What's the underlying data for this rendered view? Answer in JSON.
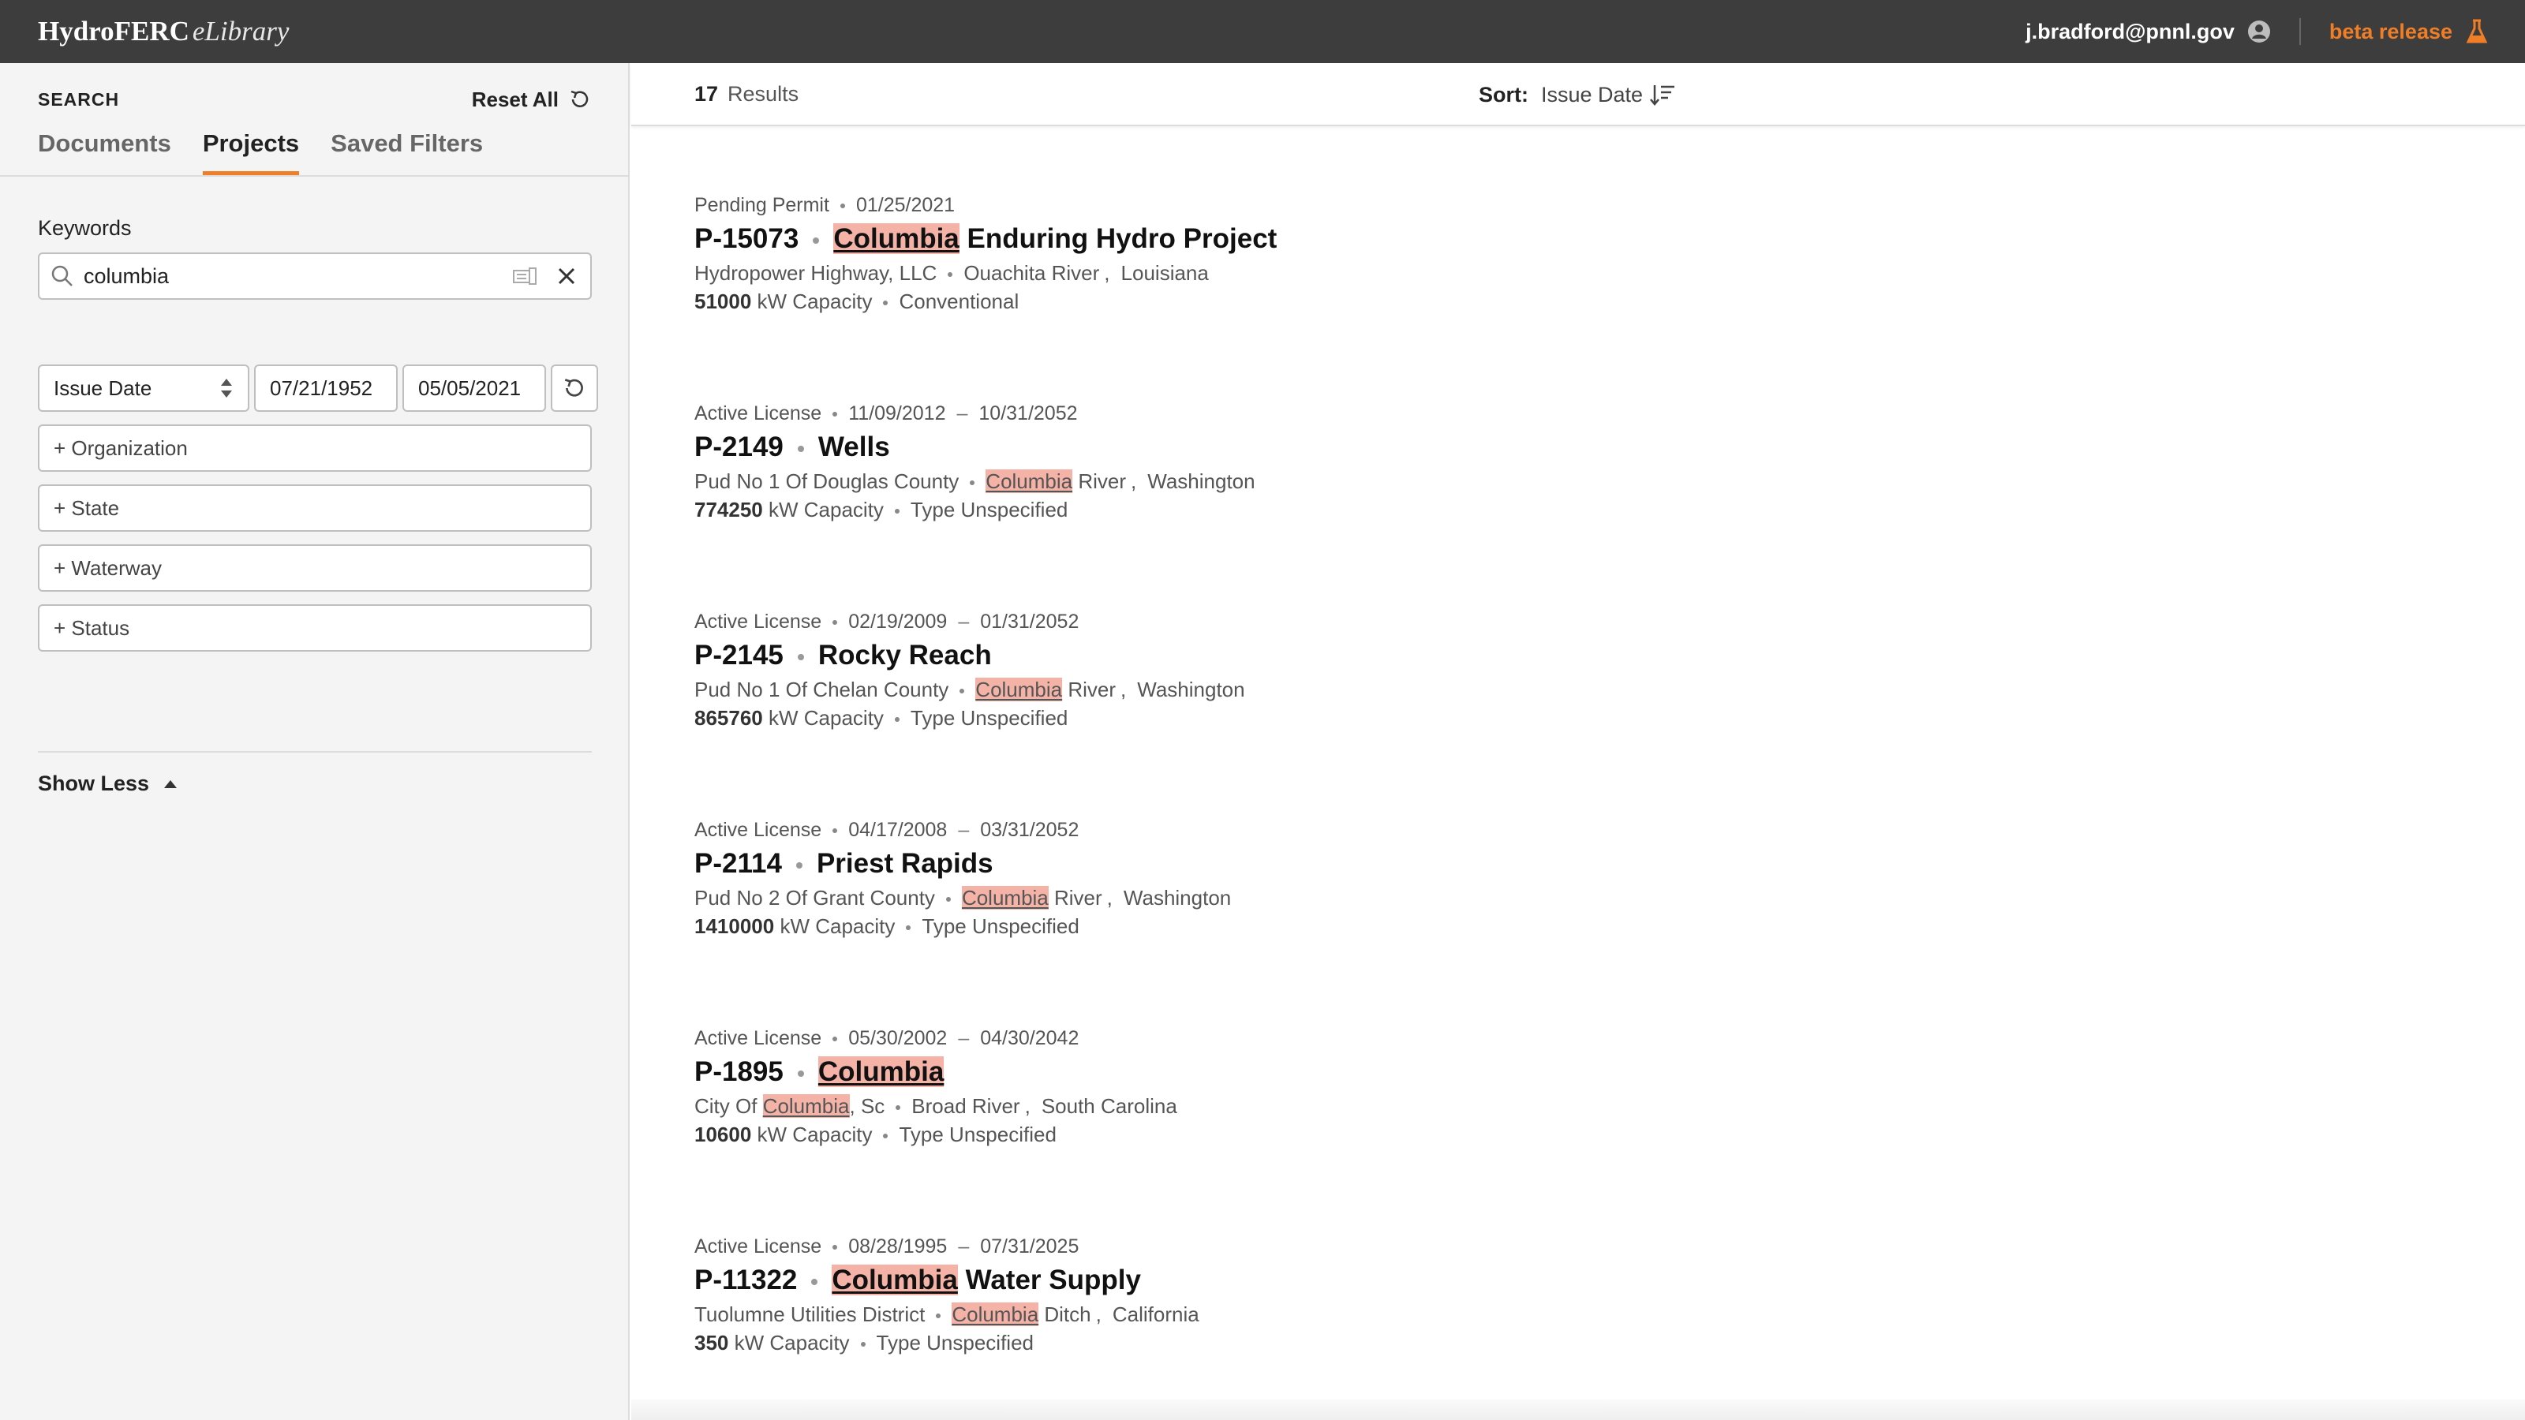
{
  "app": {
    "logo_bold": "HydroFERC",
    "logo_italic": "eLibrary"
  },
  "header": {
    "user_email": "j.bradford@pnnl.gov",
    "beta_label": "beta release"
  },
  "sidebar": {
    "title": "SEARCH",
    "reset_label": "Reset All",
    "tabs": [
      {
        "label": "Documents"
      },
      {
        "label": "Projects"
      },
      {
        "label": "Saved Filters"
      }
    ],
    "active_tab": "Projects",
    "keywords_label": "Keywords",
    "keywords_value": "columbia",
    "date_field": "Issue Date",
    "date_from": "07/21/1952",
    "date_to": "05/05/2021",
    "filters": [
      {
        "label": "+ Organization"
      },
      {
        "label": "+ State"
      },
      {
        "label": "+ Waterway"
      },
      {
        "label": "+ Status"
      }
    ],
    "show_less_label": "Show Less"
  },
  "results": {
    "count": "17",
    "count_label": "Results",
    "sort_label": "Sort:",
    "sort_value": "Issue Date",
    "items": [
      {
        "status": "Pending Permit",
        "date1": "01/25/2021",
        "date2": "",
        "id": "P-15073",
        "name_hl": "Columbia",
        "name_rest": " Enduring Hydro Project",
        "org_pre": "Hydropower Highway, LLC",
        "org_hl": "",
        "org_post": "",
        "river_hl": "",
        "river_rest": "Ouachita River",
        "state": "Louisiana",
        "capacity": "51000",
        "capacity_unit": "kW Capacity",
        "type": "Conventional"
      },
      {
        "status": "Active License",
        "date1": "11/09/2012",
        "date2": "10/31/2052",
        "id": "P-2149",
        "name_hl": "",
        "name_rest": "Wells",
        "org_pre": "Pud No 1 Of Douglas County",
        "org_hl": "",
        "org_post": "",
        "river_hl": "Columbia",
        "river_rest": " River",
        "state": "Washington",
        "capacity": "774250",
        "capacity_unit": "kW Capacity",
        "type": "Type Unspecified"
      },
      {
        "status": "Active License",
        "date1": "02/19/2009",
        "date2": "01/31/2052",
        "id": "P-2145",
        "name_hl": "",
        "name_rest": "Rocky Reach",
        "org_pre": "Pud No 1 Of Chelan County",
        "org_hl": "",
        "org_post": "",
        "river_hl": "Columbia",
        "river_rest": " River",
        "state": "Washington",
        "capacity": "865760",
        "capacity_unit": "kW Capacity",
        "type": "Type Unspecified"
      },
      {
        "status": "Active License",
        "date1": "04/17/2008",
        "date2": "03/31/2052",
        "id": "P-2114",
        "name_hl": "",
        "name_rest": "Priest Rapids",
        "org_pre": "Pud No 2 Of Grant County",
        "org_hl": "",
        "org_post": "",
        "river_hl": "Columbia",
        "river_rest": " River",
        "state": "Washington",
        "capacity": "1410000",
        "capacity_unit": "kW Capacity",
        "type": "Type Unspecified"
      },
      {
        "status": "Active License",
        "date1": "05/30/2002",
        "date2": "04/30/2042",
        "id": "P-1895",
        "name_hl": "Columbia",
        "name_rest": "",
        "org_pre": "City Of ",
        "org_hl": "Columbia",
        "org_post": ", Sc",
        "river_hl": "",
        "river_rest": "Broad River",
        "state": "South Carolina",
        "capacity": "10600",
        "capacity_unit": "kW Capacity",
        "type": "Type Unspecified"
      },
      {
        "status": "Active License",
        "date1": "08/28/1995",
        "date2": "07/31/2025",
        "id": "P-11322",
        "name_hl": "Columbia",
        "name_rest": " Water Supply",
        "org_pre": "Tuolumne Utilities District",
        "org_hl": "",
        "org_post": "",
        "river_hl": "Columbia",
        "river_rest": " Ditch",
        "state": "California",
        "capacity": "350",
        "capacity_unit": "kW Capacity",
        "type": "Type Unspecified"
      }
    ]
  },
  "colors": {
    "accent": "#f07e26",
    "topbar": "#3d3d3d",
    "highlight": "#f5b3a8"
  }
}
